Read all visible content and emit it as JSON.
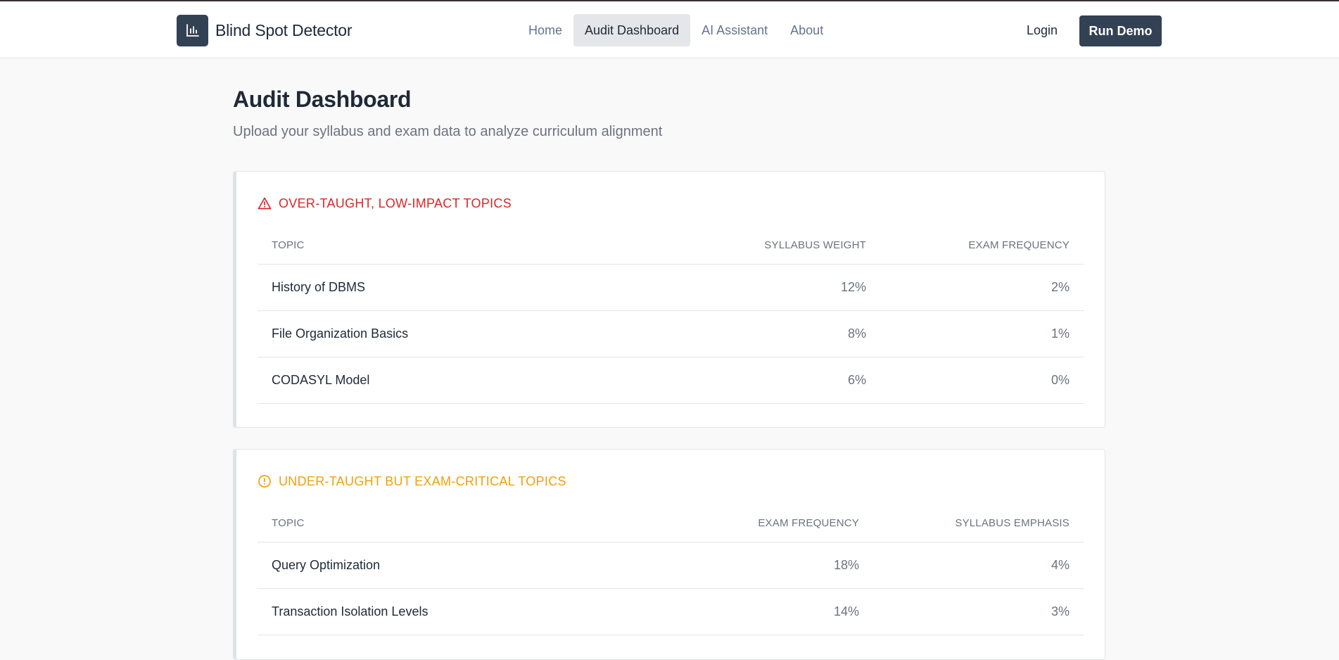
{
  "app": {
    "brand_name": "Blind Spot Detector",
    "logo_icon": "bar-chart-icon"
  },
  "nav": {
    "items": [
      {
        "label": "Home",
        "active": false
      },
      {
        "label": "Audit Dashboard",
        "active": true
      },
      {
        "label": "AI Assistant",
        "active": false
      },
      {
        "label": "About",
        "active": false
      }
    ],
    "login_label": "Login",
    "run_demo_label": "Run Demo"
  },
  "page": {
    "title": "Audit Dashboard",
    "subtitle": "Upload your syllabus and exam data to analyze curriculum alignment"
  },
  "over_taught": {
    "title": "OVER-TAUGHT, LOW-IMPACT TOPICS",
    "icon": "warning-triangle-icon",
    "color": "#dc2626",
    "columns": [
      "TOPIC",
      "SYLLABUS WEIGHT",
      "EXAM FREQUENCY"
    ],
    "rows": [
      {
        "topic": "History of DBMS",
        "syllabus_weight": "12%",
        "exam_frequency": "2%"
      },
      {
        "topic": "File Organization Basics",
        "syllabus_weight": "8%",
        "exam_frequency": "1%"
      },
      {
        "topic": "CODASYL Model",
        "syllabus_weight": "6%",
        "exam_frequency": "0%"
      }
    ]
  },
  "under_taught": {
    "title": "UNDER-TAUGHT BUT EXAM-CRITICAL TOPICS",
    "icon": "alert-circle-icon",
    "color": "#f59e0b",
    "columns": [
      "TOPIC",
      "EXAM FREQUENCY",
      "SYLLABUS EMPHASIS"
    ],
    "rows": [
      {
        "topic": "Query Optimization",
        "exam_frequency": "18%",
        "syllabus_emphasis": "4%"
      },
      {
        "topic": "Transaction Isolation Levels",
        "exam_frequency": "14%",
        "syllabus_emphasis": "3%"
      }
    ]
  }
}
